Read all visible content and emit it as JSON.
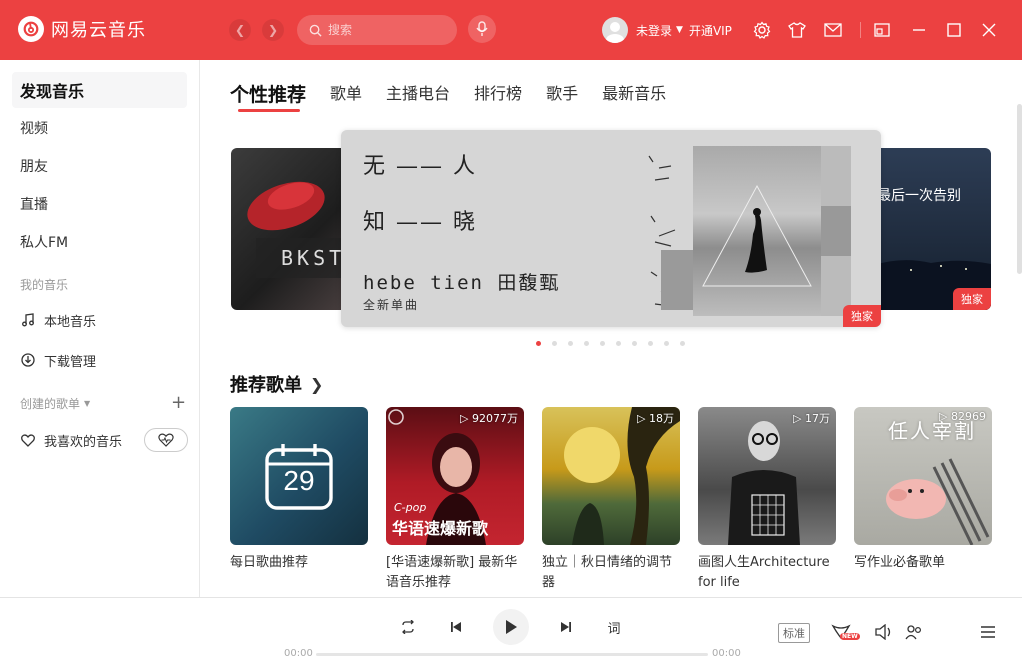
{
  "app": {
    "title": "网易云音乐"
  },
  "search": {
    "placeholder": "搜索"
  },
  "user": {
    "name": "未登录",
    "vip": "开通VIP"
  },
  "sidebar": {
    "items": [
      {
        "label": "发现音乐"
      },
      {
        "label": "视频"
      },
      {
        "label": "朋友"
      },
      {
        "label": "直播"
      },
      {
        "label": "私人FM"
      }
    ],
    "my_music_title": "我的音乐",
    "my_music": [
      {
        "label": "本地音乐",
        "icon": "music-note-icon"
      },
      {
        "label": "下载管理",
        "icon": "download-icon"
      }
    ],
    "created_title": "创建的歌单",
    "created": [
      {
        "label": "我喜欢的音乐",
        "icon": "heart-icon"
      }
    ]
  },
  "tabs": [
    {
      "label": "个性推荐"
    },
    {
      "label": "歌单"
    },
    {
      "label": "主播电台"
    },
    {
      "label": "排行榜"
    },
    {
      "label": "歌手"
    },
    {
      "label": "最新音乐"
    }
  ],
  "banner": {
    "line1": "无 —— 人",
    "line2": "知 —— 晓",
    "artist": "hebe tien 田馥甄",
    "subtitle": "全新单曲",
    "badge": "独家",
    "right_badge": "独家",
    "left_text": "BKST",
    "right_text": "最后一次告别",
    "dot_count": 10,
    "active_dot": 0
  },
  "section": {
    "title": "推荐歌单"
  },
  "playlists": [
    {
      "title": "每日歌曲推荐",
      "count": "",
      "day": "29",
      "cover_color": "#2a5a6e"
    },
    {
      "title": "[华语速爆新歌] 最新华语音乐推荐",
      "count": "92077万",
      "cover_text_top": "C-pop",
      "cover_text": "华语速爆新歌",
      "cover_color": "#a11822"
    },
    {
      "title": "独立｜秋日情绪的调节器",
      "count": "18万",
      "cover_color": "#c79a1a"
    },
    {
      "title": "画图人生Architecture for life",
      "count": "17万",
      "cover_color": "#5a5a5a"
    },
    {
      "title": "写作业必备歌单",
      "count": "82969",
      "cover_text": "任人宰割",
      "cover_color": "#bdbdb5"
    }
  ],
  "player": {
    "time_current": "00:00",
    "time_total": "00:00",
    "lyric_button": "词",
    "quality": "标准",
    "new_tag": "NEW"
  },
  "colors": {
    "brand": "#ec4141"
  }
}
